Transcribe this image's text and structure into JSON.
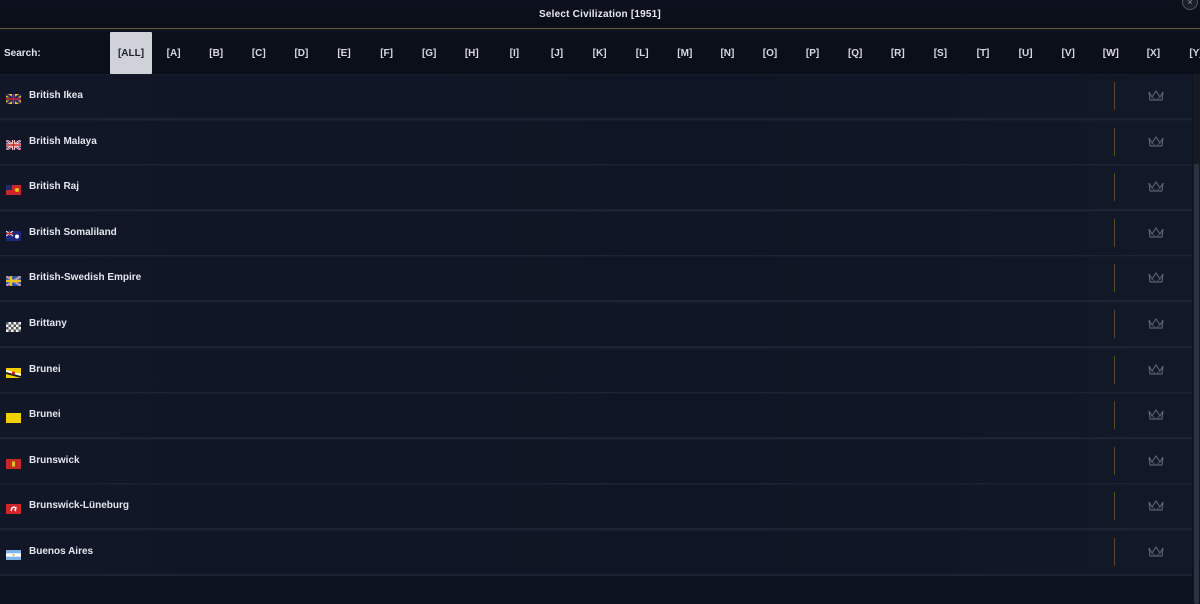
{
  "window": {
    "title": "Select Civilization [1951]"
  },
  "search": {
    "label": "Search:"
  },
  "letters": [
    "[ALL]",
    "[A]",
    "[B]",
    "[C]",
    "[D]",
    "[E]",
    "[F]",
    "[G]",
    "[H]",
    "[I]",
    "[J]",
    "[K]",
    "[L]",
    "[M]",
    "[N]",
    "[O]",
    "[P]",
    "[Q]",
    "[R]",
    "[S]",
    "[T]",
    "[U]",
    "[V]",
    "[W]",
    "[X]",
    "[Y]"
  ],
  "active_letter": "[ALL]",
  "civilizations": [
    {
      "name": "British Ikea",
      "flag": "union-jack-yellow-flag-icon"
    },
    {
      "name": "British Malaya",
      "flag": "union-jack-flag-icon"
    },
    {
      "name": "British Raj",
      "flag": "red-ensign-flag-icon"
    },
    {
      "name": "British Somaliland",
      "flag": "blue-ensign-flag-icon"
    },
    {
      "name": "British-Swedish Empire",
      "flag": "union-swedish-flag-icon"
    },
    {
      "name": "Brittany",
      "flag": "checkered-flag-icon"
    },
    {
      "name": "Brunei",
      "flag": "brunei-striped-flag-icon"
    },
    {
      "name": "Brunei",
      "flag": "yellow-flag-icon"
    },
    {
      "name": "Brunswick",
      "flag": "red-crest-flag-icon"
    },
    {
      "name": "Brunswick-Lüneburg",
      "flag": "red-horse-flag-icon"
    },
    {
      "name": "Buenos Aires",
      "flag": "light-blue-white-flag-icon"
    }
  ]
}
